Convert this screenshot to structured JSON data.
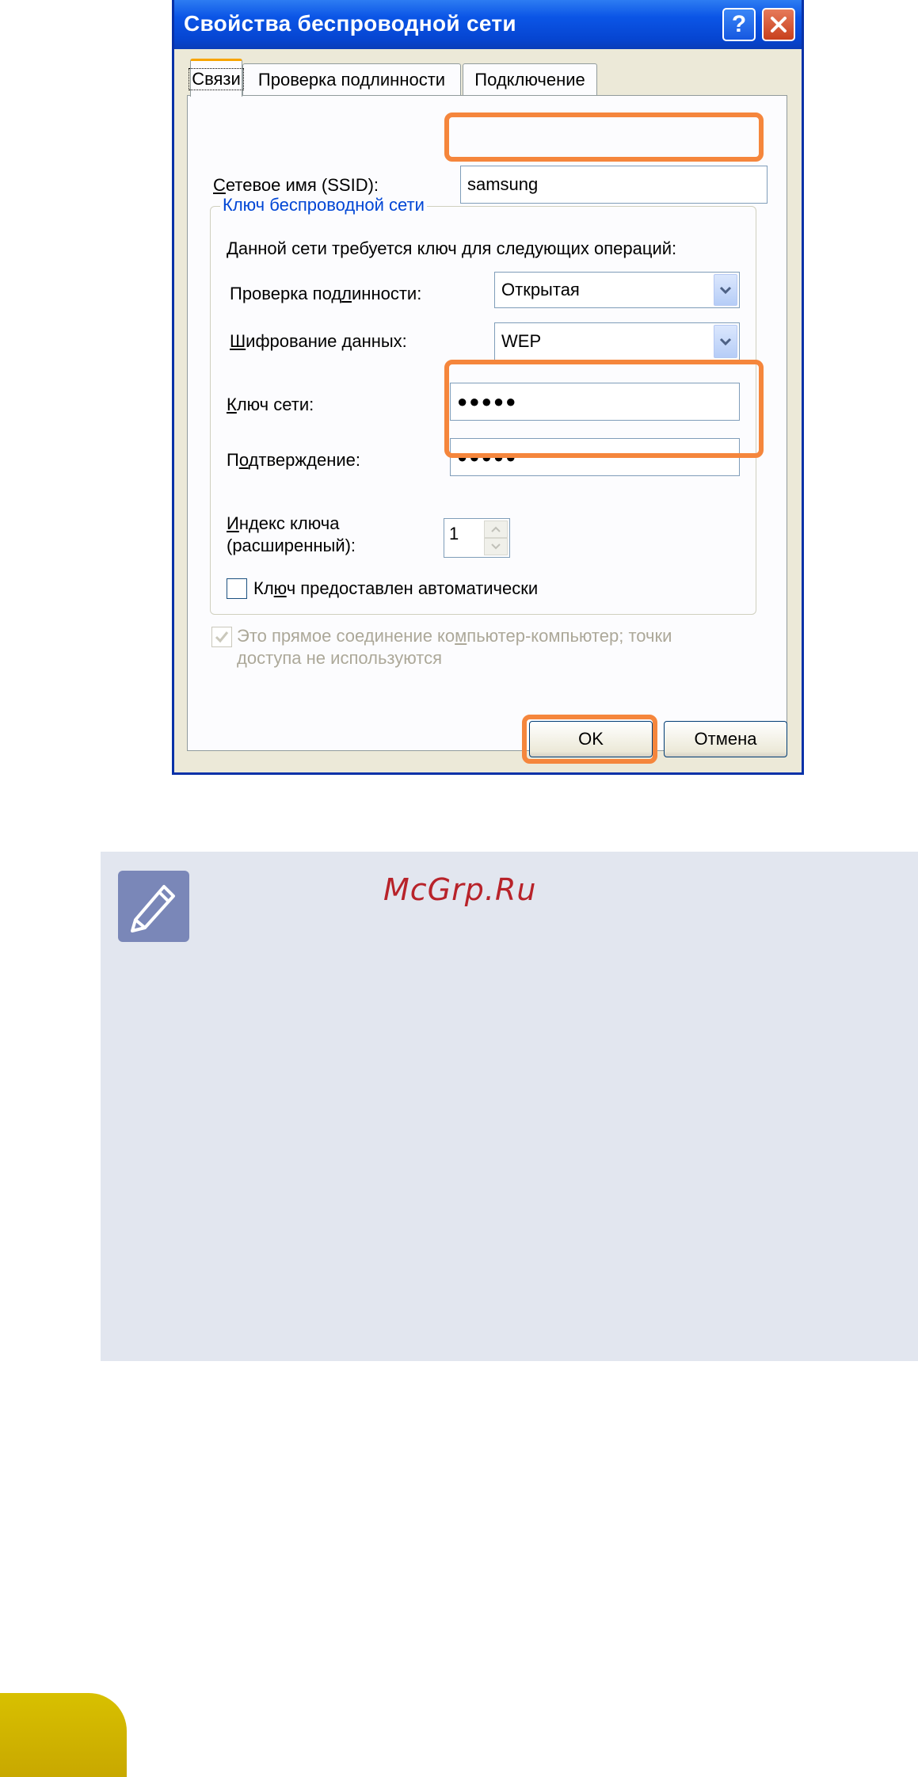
{
  "dialog": {
    "title": "Свойства беспроводной сети",
    "help_glyph": "?",
    "tabs": [
      {
        "label": "Связи"
      },
      {
        "label": "Проверка подлинности"
      },
      {
        "label": "Подключение"
      }
    ],
    "ssid": {
      "label_hotkey": "С",
      "label_rest": "етевое имя (SSID):",
      "value": "samsung"
    },
    "group": {
      "title": "Ключ беспроводной сети",
      "intro": "Данной сети требуется ключ для следующих операций:",
      "auth": {
        "label_pre": "Проверка под",
        "label_hotkey": "л",
        "label_post": "инности:",
        "value": "Открытая"
      },
      "encryption": {
        "label_hotkey": "Ш",
        "label_rest": "ифрование данных:",
        "value": "WEP"
      },
      "network_key": {
        "label_hotkey": "К",
        "label_rest": "люч сети:",
        "value": "●●●●●"
      },
      "confirm": {
        "label_pre": "П",
        "label_hotkey": "о",
        "label_post": "дтверждение:",
        "value": "●●●●●"
      },
      "key_index": {
        "label_pre": "",
        "label_hotkey": "И",
        "label_line1_rest": "ндекс ключа",
        "label_line2": "(расширенный):",
        "value": "1"
      },
      "auto_key": {
        "label_pre": "Кл",
        "label_hotkey": "ю",
        "label_post": "ч предоставлен автоматически",
        "checked": false
      }
    },
    "adhoc": {
      "line1_pre": "Это прямое соединение ко",
      "line1_hotkey": "м",
      "line1_post": "пьютер-компьютер; точки",
      "line2": "доступа не используются",
      "checked": true,
      "enabled": false
    },
    "buttons": {
      "ok": "OK",
      "cancel": "Отмена"
    },
    "highlight_color": "#f5863c"
  },
  "note": {
    "icon": "pencil-note-icon",
    "watermark": "McGrp.Ru",
    "background": "#e2e6ef"
  }
}
